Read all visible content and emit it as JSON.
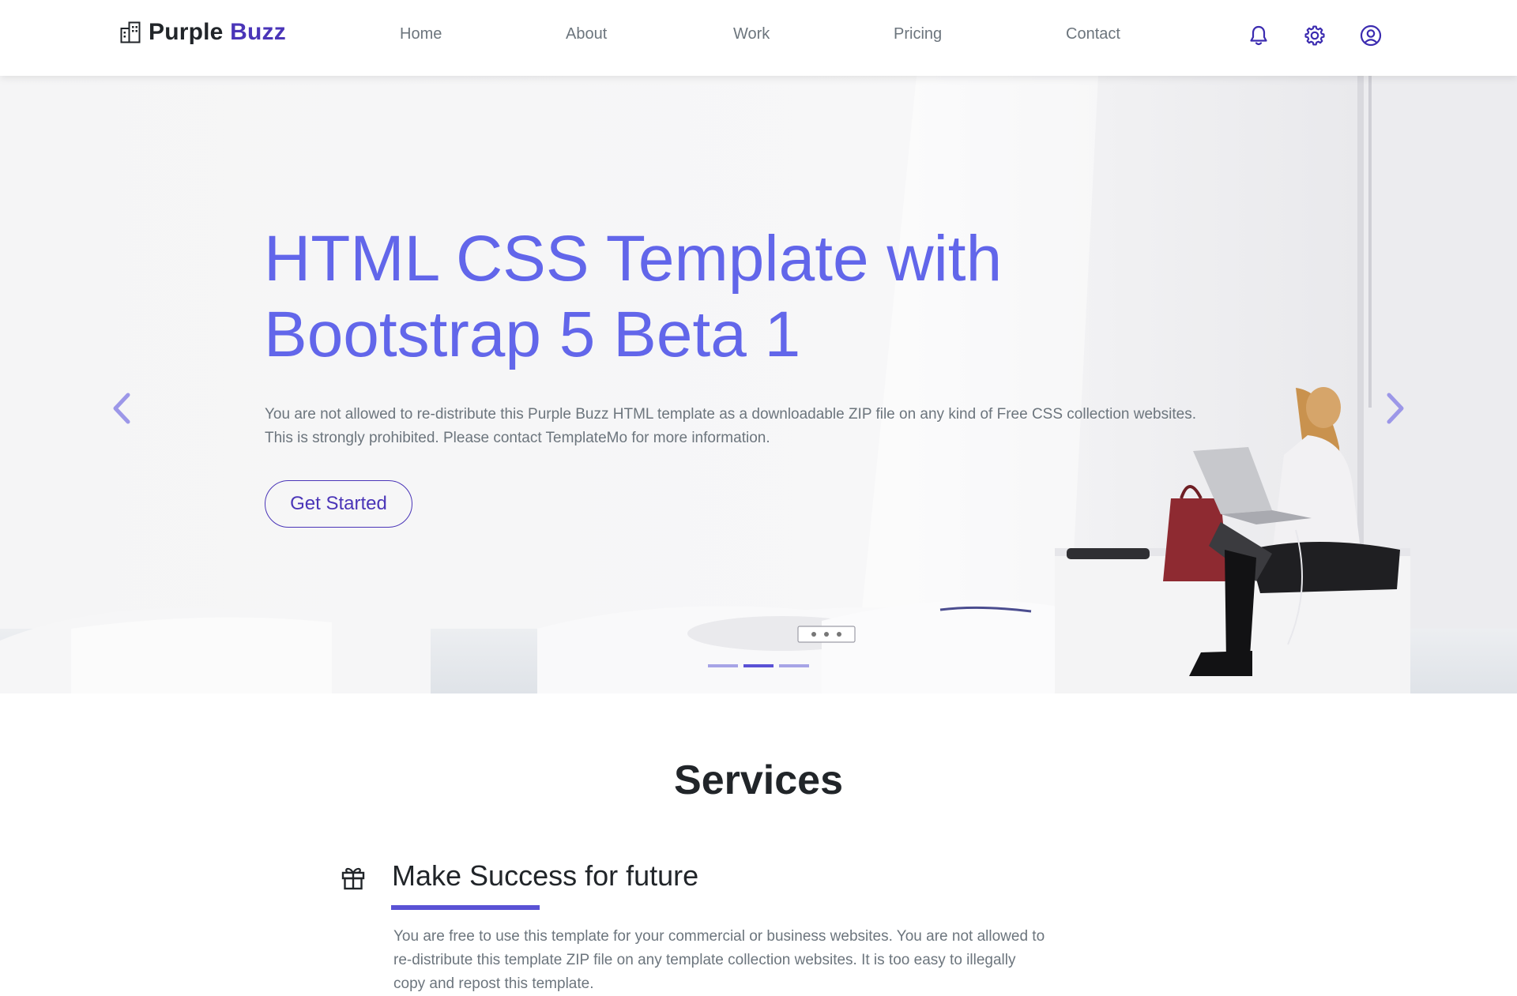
{
  "brand": {
    "name_part1": "Purple",
    "name_part2": "Buzz",
    "icon": "building-icon"
  },
  "nav": {
    "items": [
      {
        "label": "Home"
      },
      {
        "label": "About"
      },
      {
        "label": "Work"
      },
      {
        "label": "Pricing"
      },
      {
        "label": "Contact"
      }
    ],
    "icons": [
      "bell-icon",
      "gear-icon",
      "user-circle-icon"
    ]
  },
  "hero": {
    "title_line1": "HTML CSS Template with",
    "title_line2": "Bootstrap 5 Beta 1",
    "text_line1": "You are not allowed to re-distribute this Purple Buzz HTML template as a downloadable ZIP file on any kind of Free CSS collection websites.",
    "text_line2": "This is strongly prohibited. Please contact TemplateMo for more information.",
    "cta_label": "Get Started",
    "slide_count": 3,
    "active_slide": 2
  },
  "services": {
    "title": "Services",
    "item": {
      "icon": "gift-icon",
      "heading": "Make Success for future",
      "text_line1": "You are free to use this template for your commercial or business websites. You are not allowed to",
      "text_line2": "re-distribute this template ZIP file on any template collection websites. It is too easy to illegally",
      "text_line3": "copy and repost this template."
    }
  },
  "colors": {
    "accent": "#4a35b8",
    "hero_title": "#6266ea",
    "indicator_active": "#5a52d5",
    "indicator": "#a7a4e6",
    "muted_text": "#6c757d"
  }
}
